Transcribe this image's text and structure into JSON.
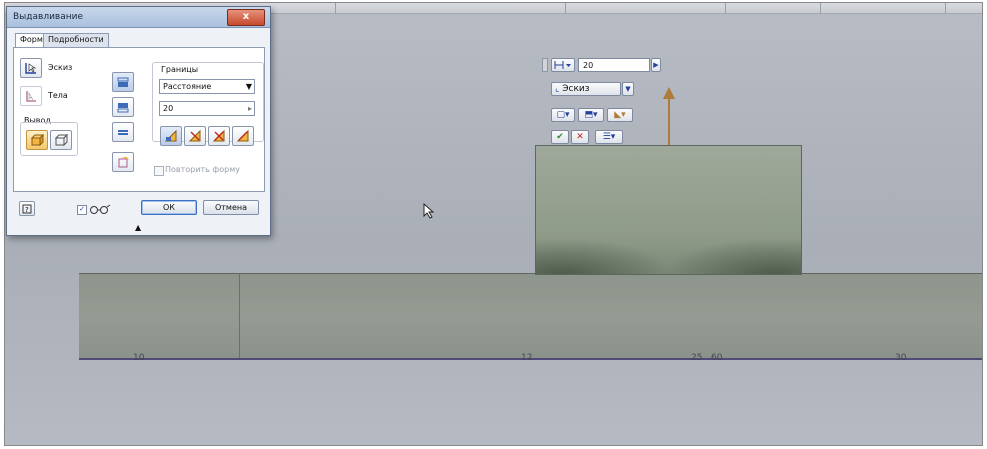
{
  "dialog": {
    "title": "Выдавливание",
    "close_label": "x",
    "tabs": [
      "Форма",
      "Подробности"
    ],
    "profile_label": "Эскиз",
    "solids_label": "Тела",
    "output_label": "Вывод",
    "extents_label": "Границы",
    "extents_type": "Расстояние",
    "distance_value": "20",
    "match_shape_label": "Повторить форму",
    "ok_label": "ОК",
    "cancel_label": "Отмена",
    "expand_arrow": "▲"
  },
  "mini_toolbar": {
    "distance_value": "20",
    "profile_label": "Эскиз",
    "ok_icon": "✔",
    "cancel_icon": "✕"
  },
  "dimensions": [
    "10",
    "12",
    "25",
    "60",
    "30"
  ],
  "colors": {
    "base_block": "#959b92",
    "extrusion": "#8f9b88",
    "direction_arrow": "#b07a3a",
    "background": "#aeb3bb"
  }
}
